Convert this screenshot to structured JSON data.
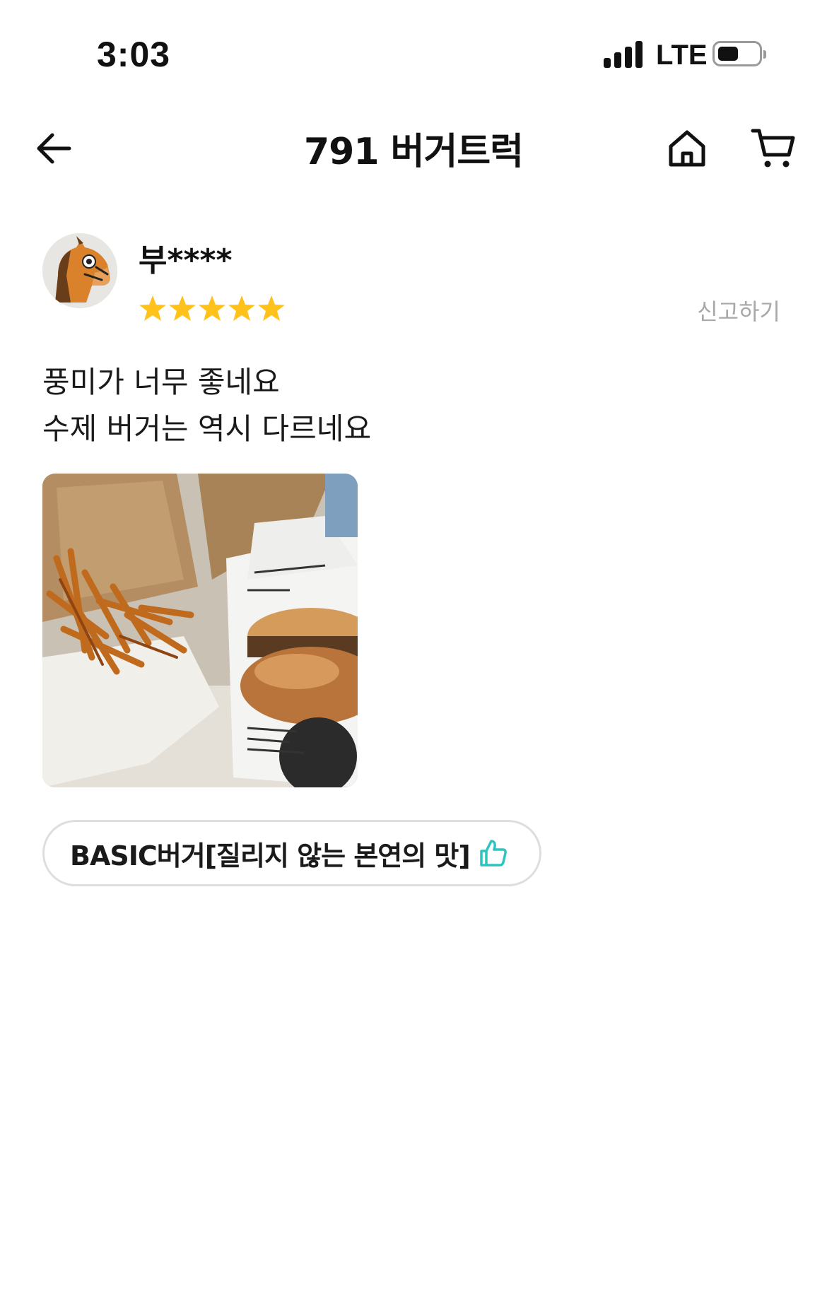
{
  "status_bar": {
    "time": "3:03",
    "network": "LTE",
    "icons": [
      "signal-icon",
      "battery-icon"
    ]
  },
  "nav": {
    "title": "791 버거트럭",
    "icons": [
      "back-arrow-icon",
      "home-icon",
      "cart-icon"
    ]
  },
  "review": {
    "reviewer_name": "부****",
    "rating": 5,
    "rating_max": 5,
    "report_label": "신고하기",
    "text_lines": [
      "풍미가 너무 좋네요",
      "수제 버거는 역시 다르네요"
    ],
    "photo_icon": "burger-and-fries-photo",
    "menu_tag": {
      "label": "BASIC버거[질리지 않는 본연의 맛]",
      "icon": "thumbs-up-icon"
    }
  },
  "colors": {
    "star": "#FFC21A",
    "thumb": "#2EC4C0",
    "muted_text": "#A8A8A8",
    "tag_border": "#DEDEDE"
  }
}
